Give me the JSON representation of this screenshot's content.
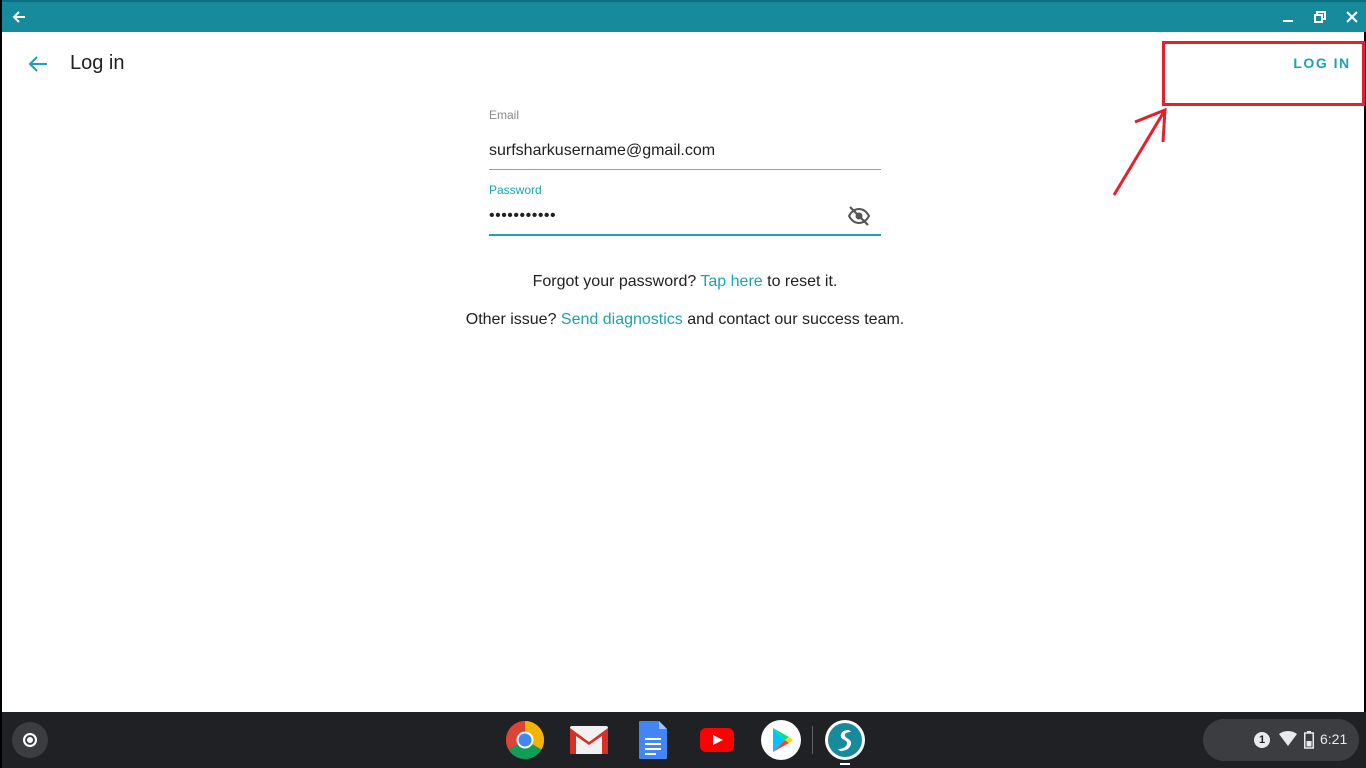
{
  "window": {
    "back_icon": "arrow-left-icon",
    "minimize_icon": "minimize-icon",
    "maximize_icon": "restore-icon",
    "close_icon": "close-icon",
    "titlebar_color": "#178a9c"
  },
  "appbar": {
    "title": "Log in",
    "action_label": "LOG IN",
    "accent_color": "#1aa3b5"
  },
  "form": {
    "email": {
      "label": "Email",
      "value": "surfsharkusername@gmail.com"
    },
    "password": {
      "label": "Password",
      "value": "•••••••••••",
      "toggle_icon": "eye-off-icon"
    }
  },
  "help": {
    "forgot_prefix": "Forgot your password?",
    "forgot_link": "Tap here",
    "forgot_suffix": "to reset it.",
    "other_prefix": "Other issue?",
    "other_link": "Send diagnostics",
    "other_suffix": "and contact our success team."
  },
  "annotation": {
    "color": "#e3202b"
  },
  "shelf": {
    "apps": [
      {
        "name": "chrome-icon"
      },
      {
        "name": "gmail-icon"
      },
      {
        "name": "docs-icon"
      },
      {
        "name": "youtube-icon"
      },
      {
        "name": "play-store-icon"
      },
      {
        "name": "surfshark-icon"
      }
    ],
    "tray": {
      "notification_count": "1",
      "time": "6:21"
    }
  }
}
